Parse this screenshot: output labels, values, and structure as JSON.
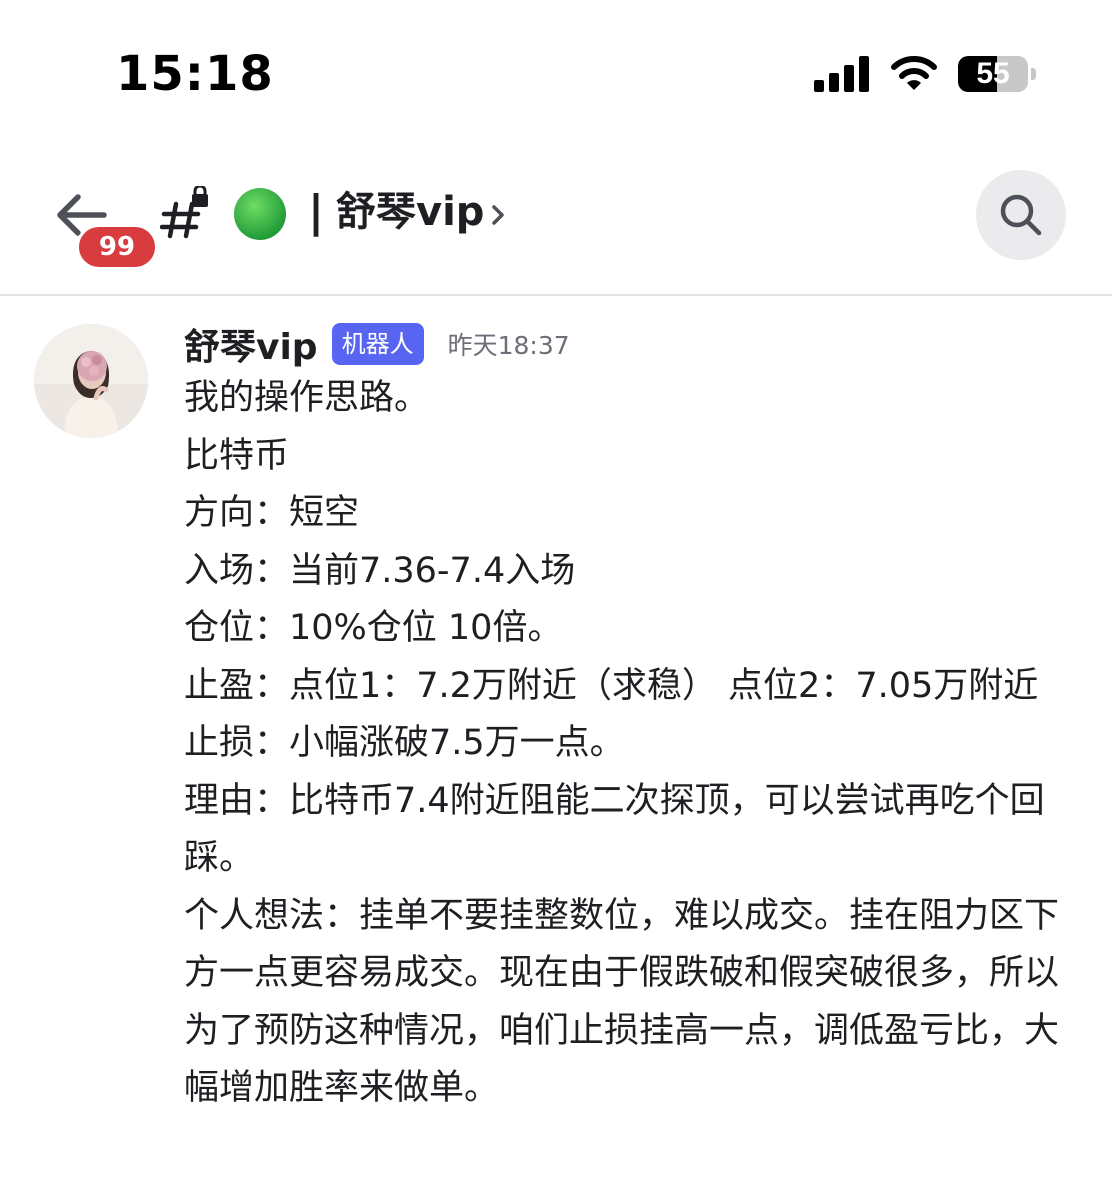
{
  "status_bar": {
    "time": "15:18",
    "battery": "55",
    "battery_level_percent": 55
  },
  "header": {
    "unread_count": "99",
    "channel_separator": "|",
    "channel_name": "舒琴vip",
    "status_dot_color": "#2fb344",
    "icons": [
      "back-arrow-icon",
      "locked-hash-channel-icon",
      "green-circle-status-icon",
      "chevron-right-icon",
      "search-icon"
    ]
  },
  "message": {
    "author": "舒琴vip",
    "bot_badge": "机器人",
    "timestamp": "昨天18:37",
    "lines": [
      "我的操作思路。",
      "比特币",
      "方向：短空",
      "入场：当前7.36-7.4入场",
      "仓位：10%仓位 10倍。",
      "止盈：点位1：7.2万附近（求稳） 点位2：7.05万附近",
      "止损：小幅涨破7.5万一点。",
      "理由：比特币7.4附近阻能二次探顶，可以尝试再吃个回踩。",
      "个人想法：挂单不要挂整数位，难以成交。挂在阻力区下方一点更容易成交。现在由于假跌破和假突破很多，所以为了预防这种情况，咱们止损挂高一点，调低盈亏比，大幅增加胜率来做单。"
    ]
  },
  "colors": {
    "badge_red": "#d83c3e",
    "bot_badge_blue": "#5865f2",
    "timestamp_gray": "#6d6f78"
  }
}
